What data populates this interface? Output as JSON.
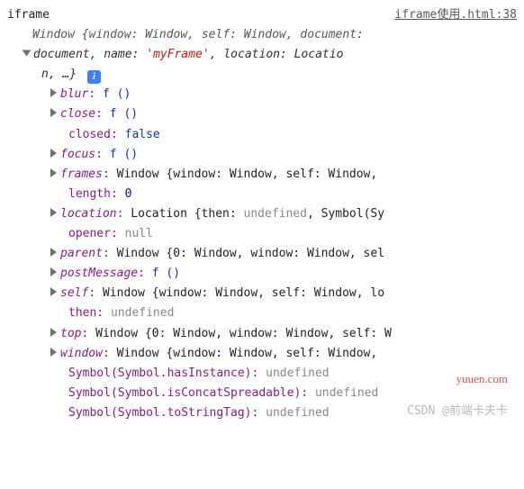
{
  "header": {
    "label": "iframe",
    "source": "iframe使用.html:38"
  },
  "objline": {
    "pre": "Window {window: Window, self: Window, document:",
    "line2a": "document",
    "line2b": ", name: ",
    "line2name": "'myFrame'",
    "line2c": ", location: Locatio",
    "line3a": "n, …}"
  },
  "props": {
    "blur": {
      "k": "blur",
      "v": "f ()"
    },
    "close": {
      "k": "close",
      "v": "f ()"
    },
    "closed": {
      "k": "closed",
      "v": "false"
    },
    "focus": {
      "k": "focus",
      "v": "f ()"
    },
    "frames": {
      "k": "frames",
      "v": "Window {window: Window, self: Window, "
    },
    "length": {
      "k": "length",
      "v": "0"
    },
    "location": {
      "k": "location",
      "v": "Location {then: ",
      "und": "undefined",
      "tail": ", Symbol(Sy"
    },
    "opener": {
      "k": "opener",
      "v": "null"
    },
    "parent": {
      "k": "parent",
      "v": "Window {0: Window, window: Window, sel"
    },
    "postMessage": {
      "k": "postMessage",
      "v": "f ()"
    },
    "self": {
      "k": "self",
      "v": "Window {window: Window, self: Window, lo"
    },
    "then": {
      "k": "then",
      "v": "undefined"
    },
    "top": {
      "k": "top",
      "v": "Window {0: Window, window: Window, self: W"
    },
    "window": {
      "k": "window",
      "v": "Window {window: Window, self: Window, "
    },
    "sym1": {
      "k": "Symbol(Symbol.hasInstance)",
      "v": "undefined"
    },
    "sym2": {
      "k": "Symbol(Symbol.isConcatSpreadable)",
      "v": "undefined"
    },
    "sym3": {
      "k": "Symbol(Symbol.toStringTag)",
      "v": "undefined"
    }
  },
  "watermarks": {
    "w1": "",
    "w2": "CSDN @前端卡夫卡",
    "w3": "yuuen.com"
  }
}
